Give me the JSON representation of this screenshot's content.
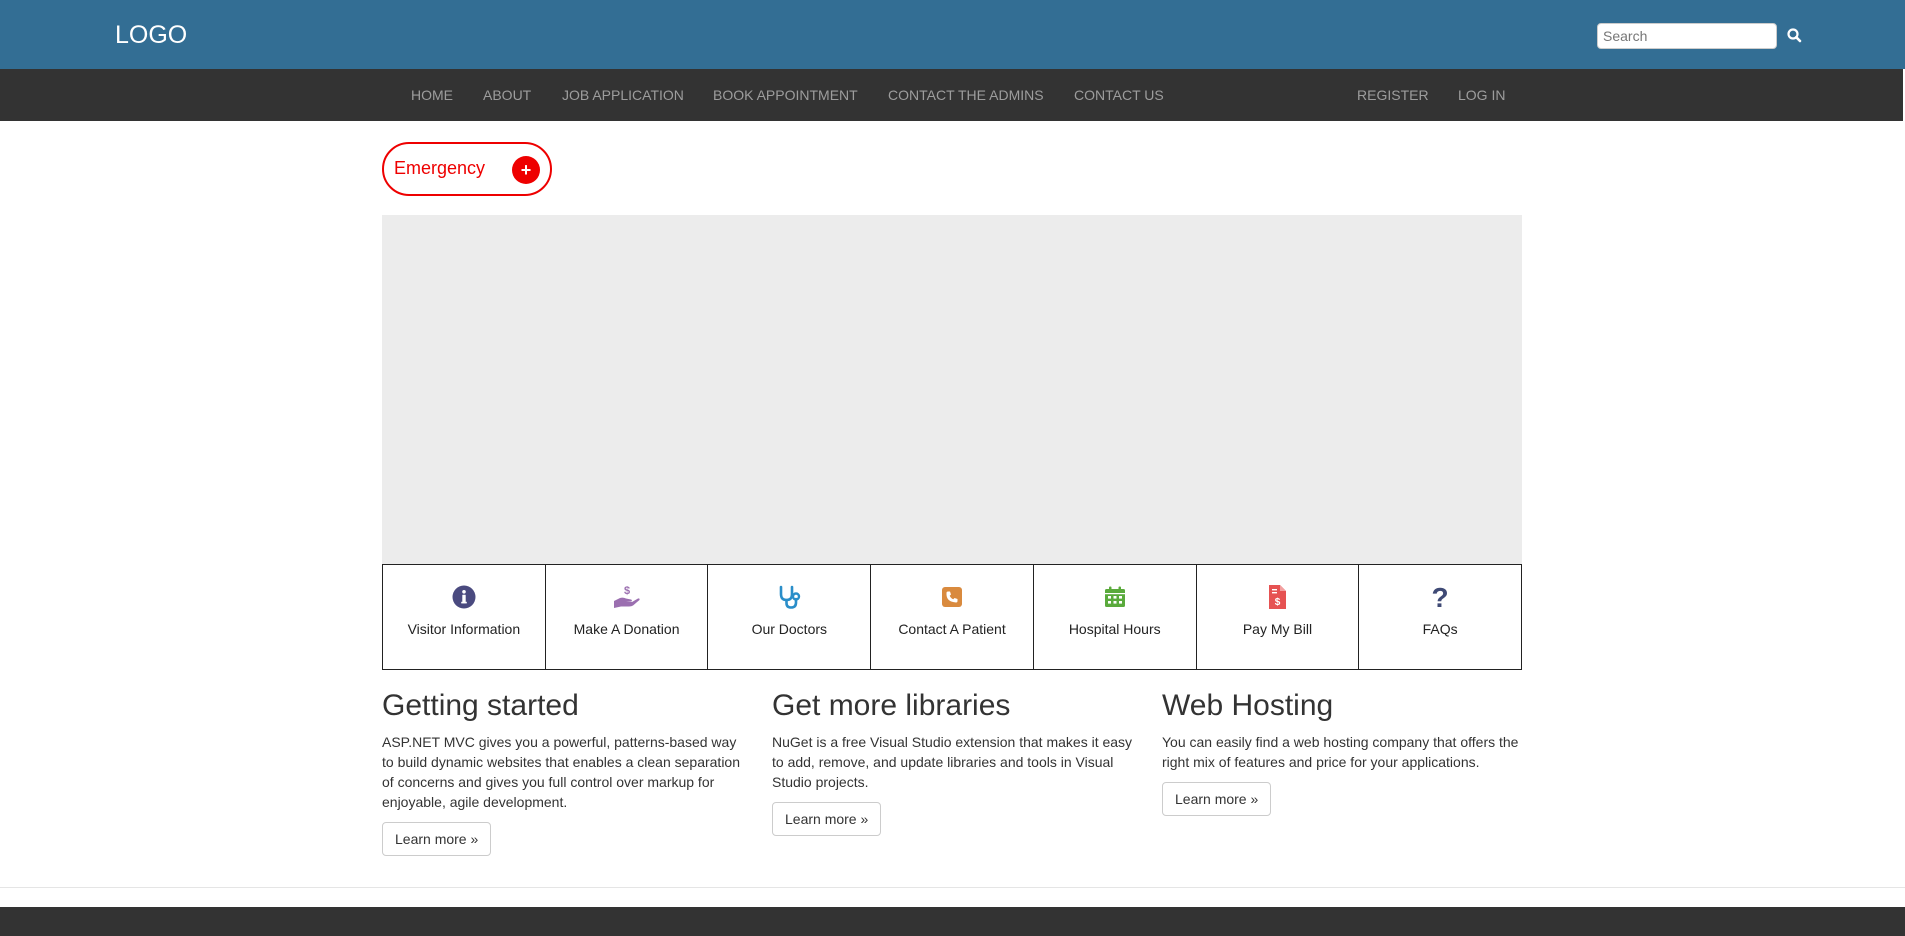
{
  "header": {
    "logo": "LOGO",
    "search_placeholder": "Search"
  },
  "nav": {
    "left": [
      "HOME",
      "ABOUT",
      "JOB APPLICATION",
      "BOOK APPOINTMENT",
      "CONTACT THE ADMINS",
      "CONTACT US"
    ],
    "right": [
      "REGISTER",
      "LOG IN"
    ]
  },
  "emergency": {
    "label": "Emergency",
    "plus": "+"
  },
  "tiles": [
    {
      "label": "Visitor Information",
      "icon": "info-icon",
      "color": "#4a4a7f"
    },
    {
      "label": "Make A Donation",
      "icon": "donation-hand-icon",
      "color": "#9b6fb0"
    },
    {
      "label": "Our Doctors",
      "icon": "stethoscope-icon",
      "color": "#2a8ec9"
    },
    {
      "label": "Contact A Patient",
      "icon": "phone-icon",
      "color": "#d98a3e"
    },
    {
      "label": "Hospital Hours",
      "icon": "calendar-icon",
      "color": "#5aaa3c"
    },
    {
      "label": "Pay My Bill",
      "icon": "bill-icon",
      "color": "#e65252"
    },
    {
      "label": "FAQs",
      "icon": "question-icon",
      "color": "#3f4a75"
    }
  ],
  "columns": [
    {
      "title": "Getting started",
      "body": "ASP.NET MVC gives you a powerful, patterns-based way to build dynamic websites that enables a clean separation of concerns and gives you full control over markup for enjoyable, agile development.",
      "button": "Learn more »"
    },
    {
      "title": "Get more libraries",
      "body": "NuGet is a free Visual Studio extension that makes it easy to add, remove, and update libraries and tools in Visual Studio projects.",
      "button": "Learn more »"
    },
    {
      "title": "Web Hosting",
      "body": "You can easily find a web hosting company that offers the right mix of features and price for your applications.",
      "button": "Learn more »"
    }
  ],
  "colors": {
    "topbar": "#336e94",
    "navbar": "#333333",
    "emergency": "#ee0000",
    "hero": "#ececec"
  }
}
